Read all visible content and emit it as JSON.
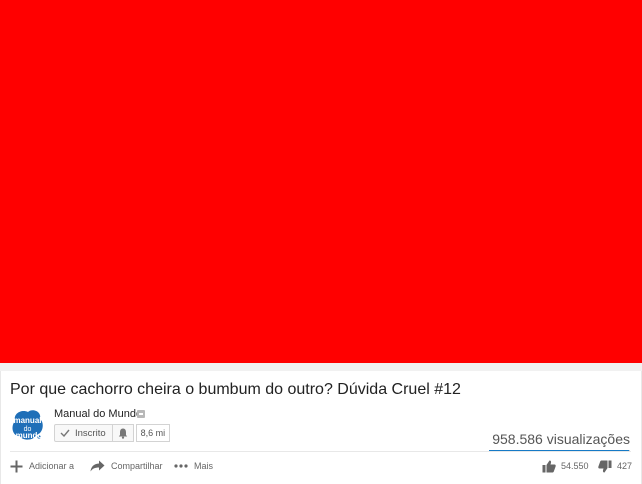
{
  "video": {
    "title": "Por que cachorro cheira o bumbum do outro? Dúvida Cruel #12",
    "player_color": "#ff0000"
  },
  "channel": {
    "name": "Manual do Mundo",
    "avatar_icon": "manual-do-mundo-logo",
    "subscribe_label": "Inscrito",
    "subscriber_count": "8,6 mi"
  },
  "stats": {
    "views": "958.586 visualizações",
    "likes": "54.550",
    "dislikes": "427",
    "like_ratio": 0.992
  },
  "actions": {
    "add_label": "Adicionar a",
    "share_label": "Compartilhar",
    "more_label": "Mais"
  },
  "colors": {
    "accent": "#167ac6",
    "icon": "#666666"
  }
}
